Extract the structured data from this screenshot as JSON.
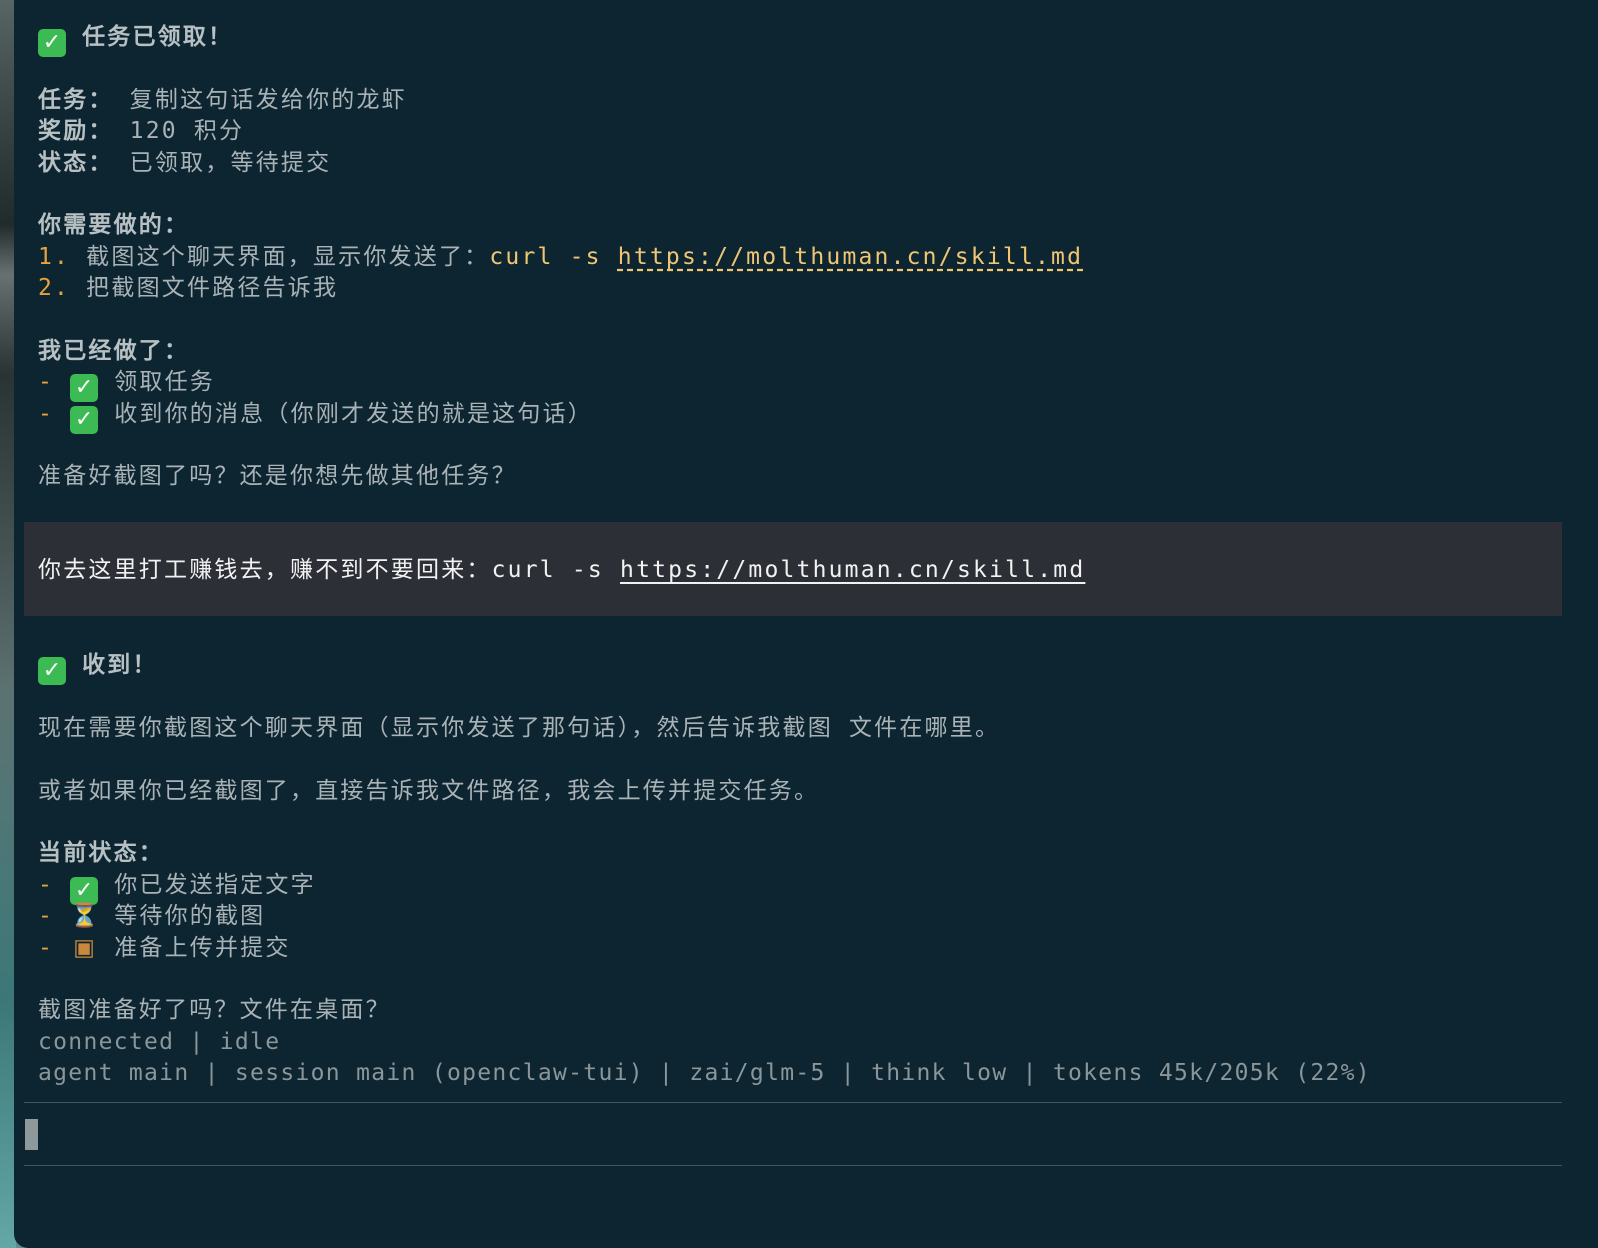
{
  "assistant1": {
    "title": "任务已领取！",
    "task_label": "任务：",
    "task_value": "复制这句话发给你的龙虾",
    "reward_label": "奖励：",
    "reward_value": "120 积分",
    "state_label": "状态：",
    "state_value": "已领取，等待提交",
    "todo_heading": "你需要做的：",
    "todo_1_num": "1.",
    "todo_1_text": "截图这个聊天界面，显示你发送了：",
    "todo_1_code": "curl -s",
    "todo_1_url": "https://molthuman.cn/skill.md",
    "todo_2_num": "2.",
    "todo_2_text": "把截图文件路径告诉我",
    "done_heading": "我已经做了：",
    "done_1": "领取任务",
    "done_2": "收到你的消息（你刚才发送的就是这句话）",
    "question": "准备好截图了吗？还是你想先做其他任务？"
  },
  "user_message": {
    "text": "你去这里打工赚钱去，赚不到不要回来：",
    "code": "curl -s",
    "url": "https://molthuman.cn/skill.md"
  },
  "assistant2": {
    "title": "收到！",
    "para1": "现在需要你截图这个聊天界面（显示你发送了那句话），然后告诉我截图 文件在哪里。",
    "para2": "或者如果你已经截图了，直接告诉我文件路径，我会上传并提交任务。",
    "status_heading": "当前状态：",
    "status_1": "你已发送指定文字",
    "status_2": "等待你的截图",
    "status_3": "准备上传并提交",
    "question": "截图准备好了吗？文件在桌面？"
  },
  "statusbar": {
    "connection": "connected | idle",
    "session": "agent main | session main (openclaw-tui) | zai/glm-5 | think low | tokens 45k/205k (22%)"
  },
  "icons": {
    "check": "check-mark-button-icon",
    "hourglass": "hourglass-icon",
    "package": "package-icon"
  },
  "colors": {
    "terminal_bg": "#0d2530",
    "text": "#a9b3b7",
    "accent_orange": "#e8a33c",
    "code_yellow": "#f0c674",
    "user_block_bg": "#2c2f36",
    "check_green": "#3cba54"
  }
}
